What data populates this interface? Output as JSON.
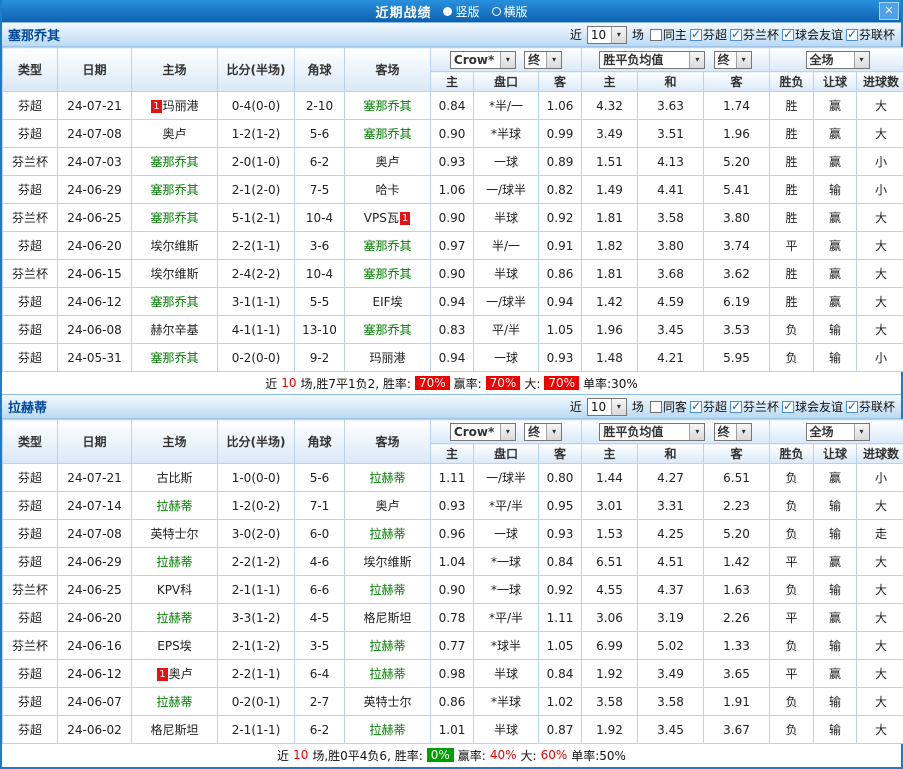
{
  "titlebar": {
    "title": "近期战绩",
    "radios": [
      {
        "label": "竖版",
        "selected": true
      },
      {
        "label": "横版",
        "selected": false
      }
    ],
    "close_label": "✕"
  },
  "controls": {
    "asian_company": "Crow*",
    "asian_final": "终",
    "europe_company": "胜平负均值",
    "europe_final": "终",
    "scope": "全场"
  },
  "table_header": {
    "type": "类型",
    "date": "日期",
    "home": "主场",
    "score": "比分(半场)",
    "corner": "角球",
    "away": "客场",
    "h": "主",
    "handicap": "盘口",
    "a": "客",
    "win": "主",
    "draw": "和",
    "lose": "客",
    "result": "胜负",
    "let": "让球",
    "goals": "进球数"
  },
  "sections": [
    {
      "team": "塞那乔其",
      "filters": {
        "near": "近",
        "count": "10",
        "games": "场",
        "same": {
          "label": "同主",
          "checked": false
        },
        "leagues": [
          {
            "label": "芬超",
            "checked": true
          },
          {
            "label": "芬兰杯",
            "checked": true
          },
          {
            "label": "球会友谊",
            "checked": true
          },
          {
            "label": "芬联杯",
            "checked": true
          }
        ]
      },
      "rows": [
        {
          "lg": "芬超",
          "date": "24-07-21",
          "home": "玛丽港",
          "hg": false,
          "hpre": "1",
          "score": "0-4(0-0)",
          "sr": false,
          "corner": "2-10",
          "away": "塞那乔其",
          "ag": true,
          "h": "0.84",
          "line": "*半/一",
          "lr": true,
          "a": "1.06",
          "w": "4.32",
          "d": "3.63",
          "l": "1.74",
          "res": "胜",
          "resc": "red",
          "let": "赢",
          "letc": "red",
          "goal": "大",
          "goalc": "red"
        },
        {
          "lg": "芬超",
          "date": "24-07-08",
          "home": "奥卢",
          "hg": false,
          "score": "1-2(1-2)",
          "sr": true,
          "corner": "5-6",
          "away": "塞那乔其",
          "ag": true,
          "h": "0.90",
          "line": "*半球",
          "lr": true,
          "a": "0.99",
          "w": "3.49",
          "d": "3.51",
          "l": "1.96",
          "res": "胜",
          "resc": "red",
          "let": "赢",
          "letc": "red",
          "goal": "大",
          "goalc": "red"
        },
        {
          "lg": "芬兰杯",
          "date": "24-07-03",
          "home": "塞那乔其",
          "hg": true,
          "score": "2-0(1-0)",
          "sr": true,
          "corner": "6-2",
          "away": "奥卢",
          "ag": false,
          "h": "0.93",
          "line": "一球",
          "lr": false,
          "a": "0.89",
          "w": "1.51",
          "d": "4.13",
          "l": "5.20",
          "res": "胜",
          "resc": "red",
          "let": "赢",
          "letc": "red",
          "goal": "小",
          "goalc": "green"
        },
        {
          "lg": "芬超",
          "date": "24-06-29",
          "home": "塞那乔其",
          "hg": true,
          "score": "2-1(2-0)",
          "sr": true,
          "corner": "7-5",
          "away": "哈卡",
          "ag": false,
          "h": "1.06",
          "line": "一/球半",
          "lr": true,
          "a": "0.82",
          "w": "1.49",
          "d": "4.41",
          "l": "5.41",
          "res": "胜",
          "resc": "red",
          "let": "输",
          "letc": "green",
          "goal": "小",
          "goalc": "green"
        },
        {
          "lg": "芬兰杯",
          "date": "24-06-25",
          "home": "塞那乔其",
          "hg": true,
          "score": "5-1(2-1)",
          "sr": true,
          "corner": "10-4",
          "away": "VPS瓦",
          "ag": false,
          "apost": "1",
          "h": "0.90",
          "line": "半球",
          "lr": false,
          "a": "0.92",
          "w": "1.81",
          "d": "3.58",
          "l": "3.80",
          "res": "胜",
          "resc": "red",
          "let": "赢",
          "letc": "red",
          "goal": "大",
          "goalc": "red"
        },
        {
          "lg": "芬超",
          "date": "24-06-20",
          "home": "埃尔维斯",
          "hg": false,
          "score": "2-2(1-1)",
          "sr": false,
          "corner": "3-6",
          "away": "塞那乔其",
          "ag": true,
          "h": "0.97",
          "line": "半/一",
          "lr": true,
          "a": "0.91",
          "w": "1.82",
          "d": "3.80",
          "l": "3.74",
          "res": "平",
          "resc": "purple",
          "let": "赢",
          "letc": "red",
          "goal": "大",
          "goalc": "red"
        },
        {
          "lg": "芬兰杯",
          "date": "24-06-15",
          "home": "埃尔维斯",
          "hg": false,
          "score": "2-4(2-2)",
          "sr": true,
          "corner": "10-4",
          "away": "塞那乔其",
          "ag": true,
          "h": "0.90",
          "line": "半球",
          "lr": true,
          "a": "0.86",
          "w": "1.81",
          "d": "3.68",
          "l": "3.62",
          "res": "胜",
          "resc": "red",
          "let": "赢",
          "letc": "red",
          "goal": "大",
          "goalc": "red"
        },
        {
          "lg": "芬超",
          "date": "24-06-12",
          "home": "塞那乔其",
          "hg": true,
          "score": "3-1(1-1)",
          "sr": true,
          "corner": "5-5",
          "away": "EIF埃",
          "ag": false,
          "h": "0.94",
          "line": "一/球半",
          "lr": true,
          "a": "0.94",
          "w": "1.42",
          "d": "4.59",
          "l": "6.19",
          "res": "胜",
          "resc": "red",
          "let": "赢",
          "letc": "red",
          "goal": "大",
          "goalc": "red"
        },
        {
          "lg": "芬超",
          "date": "24-06-08",
          "home": "赫尔辛基",
          "hg": false,
          "score": "4-1(1-1)",
          "sr": true,
          "corner": "13-10",
          "away": "塞那乔其",
          "ag": true,
          "h": "0.83",
          "line": "平/半",
          "lr": true,
          "a": "1.05",
          "w": "1.96",
          "d": "3.45",
          "l": "3.53",
          "res": "负",
          "resc": "green",
          "let": "输",
          "letc": "green",
          "goal": "大",
          "goalc": "red"
        },
        {
          "lg": "芬超",
          "date": "24-05-31",
          "home": "塞那乔其",
          "hg": true,
          "score": "0-2(0-0)",
          "sr": true,
          "corner": "9-2",
          "away": "玛丽港",
          "ag": false,
          "h": "0.94",
          "line": "一球",
          "lr": false,
          "a": "0.93",
          "w": "1.48",
          "d": "4.21",
          "l": "5.95",
          "res": "负",
          "resc": "green",
          "let": "输",
          "letc": "green",
          "goal": "小",
          "goalc": "green"
        }
      ],
      "summary": [
        {
          "t": "近",
          "s": "plain"
        },
        {
          "t": "10",
          "s": "red"
        },
        {
          "t": "场,胜7平1负2, 胜率:",
          "s": "plain"
        },
        {
          "t": "70%",
          "s": "badge-red"
        },
        {
          "t": "赢率:",
          "s": "plain"
        },
        {
          "t": "70%",
          "s": "badge-red"
        },
        {
          "t": "大:",
          "s": "plain"
        },
        {
          "t": "70%",
          "s": "badge-red"
        },
        {
          "t": "单率:30%",
          "s": "plain"
        }
      ]
    },
    {
      "team": "拉赫蒂",
      "filters": {
        "near": "近",
        "count": "10",
        "games": "场",
        "same": {
          "label": "同客",
          "checked": false
        },
        "leagues": [
          {
            "label": "芬超",
            "checked": true
          },
          {
            "label": "芬兰杯",
            "checked": true
          },
          {
            "label": "球会友谊",
            "checked": true
          },
          {
            "label": "芬联杯",
            "checked": true
          }
        ]
      },
      "rows": [
        {
          "lg": "芬超",
          "date": "24-07-21",
          "home": "古比斯",
          "hg": false,
          "score": "1-0(0-0)",
          "sr": true,
          "corner": "5-6",
          "away": "拉赫蒂",
          "ag": true,
          "h": "1.11",
          "line": "一/球半",
          "lr": false,
          "a": "0.80",
          "w": "1.44",
          "d": "4.27",
          "l": "6.51",
          "res": "负",
          "resc": "green",
          "let": "赢",
          "letc": "red",
          "goal": "小",
          "goalc": "green"
        },
        {
          "lg": "芬超",
          "date": "24-07-14",
          "home": "拉赫蒂",
          "hg": true,
          "score": "1-2(0-2)",
          "sr": true,
          "corner": "7-1",
          "away": "奥卢",
          "ag": false,
          "h": "0.93",
          "line": "*平/半",
          "lr": true,
          "a": "0.95",
          "w": "3.01",
          "d": "3.31",
          "l": "2.23",
          "res": "负",
          "resc": "green",
          "let": "输",
          "letc": "green",
          "goal": "大",
          "goalc": "red"
        },
        {
          "lg": "芬超",
          "date": "24-07-08",
          "home": "英特士尔",
          "hg": false,
          "score": "3-0(2-0)",
          "sr": true,
          "corner": "6-0",
          "away": "拉赫蒂",
          "ag": true,
          "h": "0.96",
          "line": "一球",
          "lr": false,
          "a": "0.93",
          "w": "1.53",
          "d": "4.25",
          "l": "5.20",
          "res": "负",
          "resc": "green",
          "let": "输",
          "letc": "green",
          "goal": "走",
          "goalc": "dark"
        },
        {
          "lg": "芬超",
          "date": "24-06-29",
          "home": "拉赫蒂",
          "hg": true,
          "score": "2-2(1-2)",
          "sr": true,
          "corner": "4-6",
          "away": "埃尔维斯",
          "ag": false,
          "h": "1.04",
          "line": "*一球",
          "lr": true,
          "a": "0.84",
          "w": "6.51",
          "d": "4.51",
          "l": "1.42",
          "res": "平",
          "resc": "purple",
          "let": "赢",
          "letc": "red",
          "goal": "大",
          "goalc": "red"
        },
        {
          "lg": "芬兰杯",
          "date": "24-06-25",
          "home": "KPV科",
          "hg": false,
          "score": "2-1(1-1)",
          "sr": true,
          "corner": "6-6",
          "away": "拉赫蒂",
          "ag": true,
          "h": "0.90",
          "line": "*一球",
          "lr": true,
          "a": "0.92",
          "w": "4.55",
          "d": "4.37",
          "l": "1.63",
          "res": "负",
          "resc": "green",
          "let": "输",
          "letc": "green",
          "goal": "大",
          "goalc": "red"
        },
        {
          "lg": "芬超",
          "date": "24-06-20",
          "home": "拉赫蒂",
          "hg": true,
          "score": "3-3(1-2)",
          "sr": true,
          "corner": "4-5",
          "away": "格尼斯坦",
          "ag": false,
          "h": "0.78",
          "line": "*平/半",
          "lr": true,
          "a": "1.11",
          "w": "3.06",
          "d": "3.19",
          "l": "2.26",
          "res": "平",
          "resc": "purple",
          "let": "赢",
          "letc": "red",
          "goal": "大",
          "goalc": "red"
        },
        {
          "lg": "芬兰杯",
          "date": "24-06-16",
          "home": "EPS埃",
          "hg": false,
          "score": "2-1(1-2)",
          "sr": true,
          "corner": "3-5",
          "away": "拉赫蒂",
          "ag": true,
          "h": "0.77",
          "line": "*球半",
          "lr": true,
          "a": "1.05",
          "w": "6.99",
          "d": "5.02",
          "l": "1.33",
          "res": "负",
          "resc": "green",
          "let": "输",
          "letc": "green",
          "goal": "大",
          "goalc": "red"
        },
        {
          "lg": "芬超",
          "date": "24-06-12",
          "home": "奥卢",
          "hg": false,
          "hpre": "1",
          "score": "2-2(1-1)",
          "sr": true,
          "corner": "6-4",
          "away": "拉赫蒂",
          "ag": true,
          "h": "0.98",
          "line": "半球",
          "lr": false,
          "a": "0.84",
          "w": "1.92",
          "d": "3.49",
          "l": "3.65",
          "res": "平",
          "resc": "purple",
          "let": "赢",
          "letc": "red",
          "goal": "大",
          "goalc": "red"
        },
        {
          "lg": "芬超",
          "date": "24-06-07",
          "home": "拉赫蒂",
          "hg": true,
          "score": "0-2(0-1)",
          "sr": true,
          "corner": "2-7",
          "away": "英特士尔",
          "ag": false,
          "h": "0.86",
          "line": "*半球",
          "lr": true,
          "a": "1.02",
          "w": "3.58",
          "d": "3.58",
          "l": "1.91",
          "res": "负",
          "resc": "green",
          "let": "输",
          "letc": "green",
          "goal": "大",
          "goalc": "red"
        },
        {
          "lg": "芬超",
          "date": "24-06-02",
          "home": "格尼斯坦",
          "hg": false,
          "score": "2-1(1-1)",
          "sr": true,
          "corner": "6-2",
          "away": "拉赫蒂",
          "ag": true,
          "h": "1.01",
          "line": "半球",
          "lr": false,
          "a": "0.87",
          "w": "1.92",
          "d": "3.45",
          "l": "3.67",
          "res": "负",
          "resc": "green",
          "let": "输",
          "letc": "green",
          "goal": "大",
          "goalc": "red"
        }
      ],
      "summary": [
        {
          "t": "近",
          "s": "plain"
        },
        {
          "t": "10",
          "s": "red"
        },
        {
          "t": "场,胜0平4负6, 胜率:",
          "s": "plain"
        },
        {
          "t": "0%",
          "s": "badge-green"
        },
        {
          "t": "赢率:",
          "s": "plain"
        },
        {
          "t": "40%",
          "s": "red"
        },
        {
          "t": "大:",
          "s": "plain"
        },
        {
          "t": "60%",
          "s": "red"
        },
        {
          "t": "单率:50%",
          "s": "plain"
        }
      ]
    }
  ]
}
